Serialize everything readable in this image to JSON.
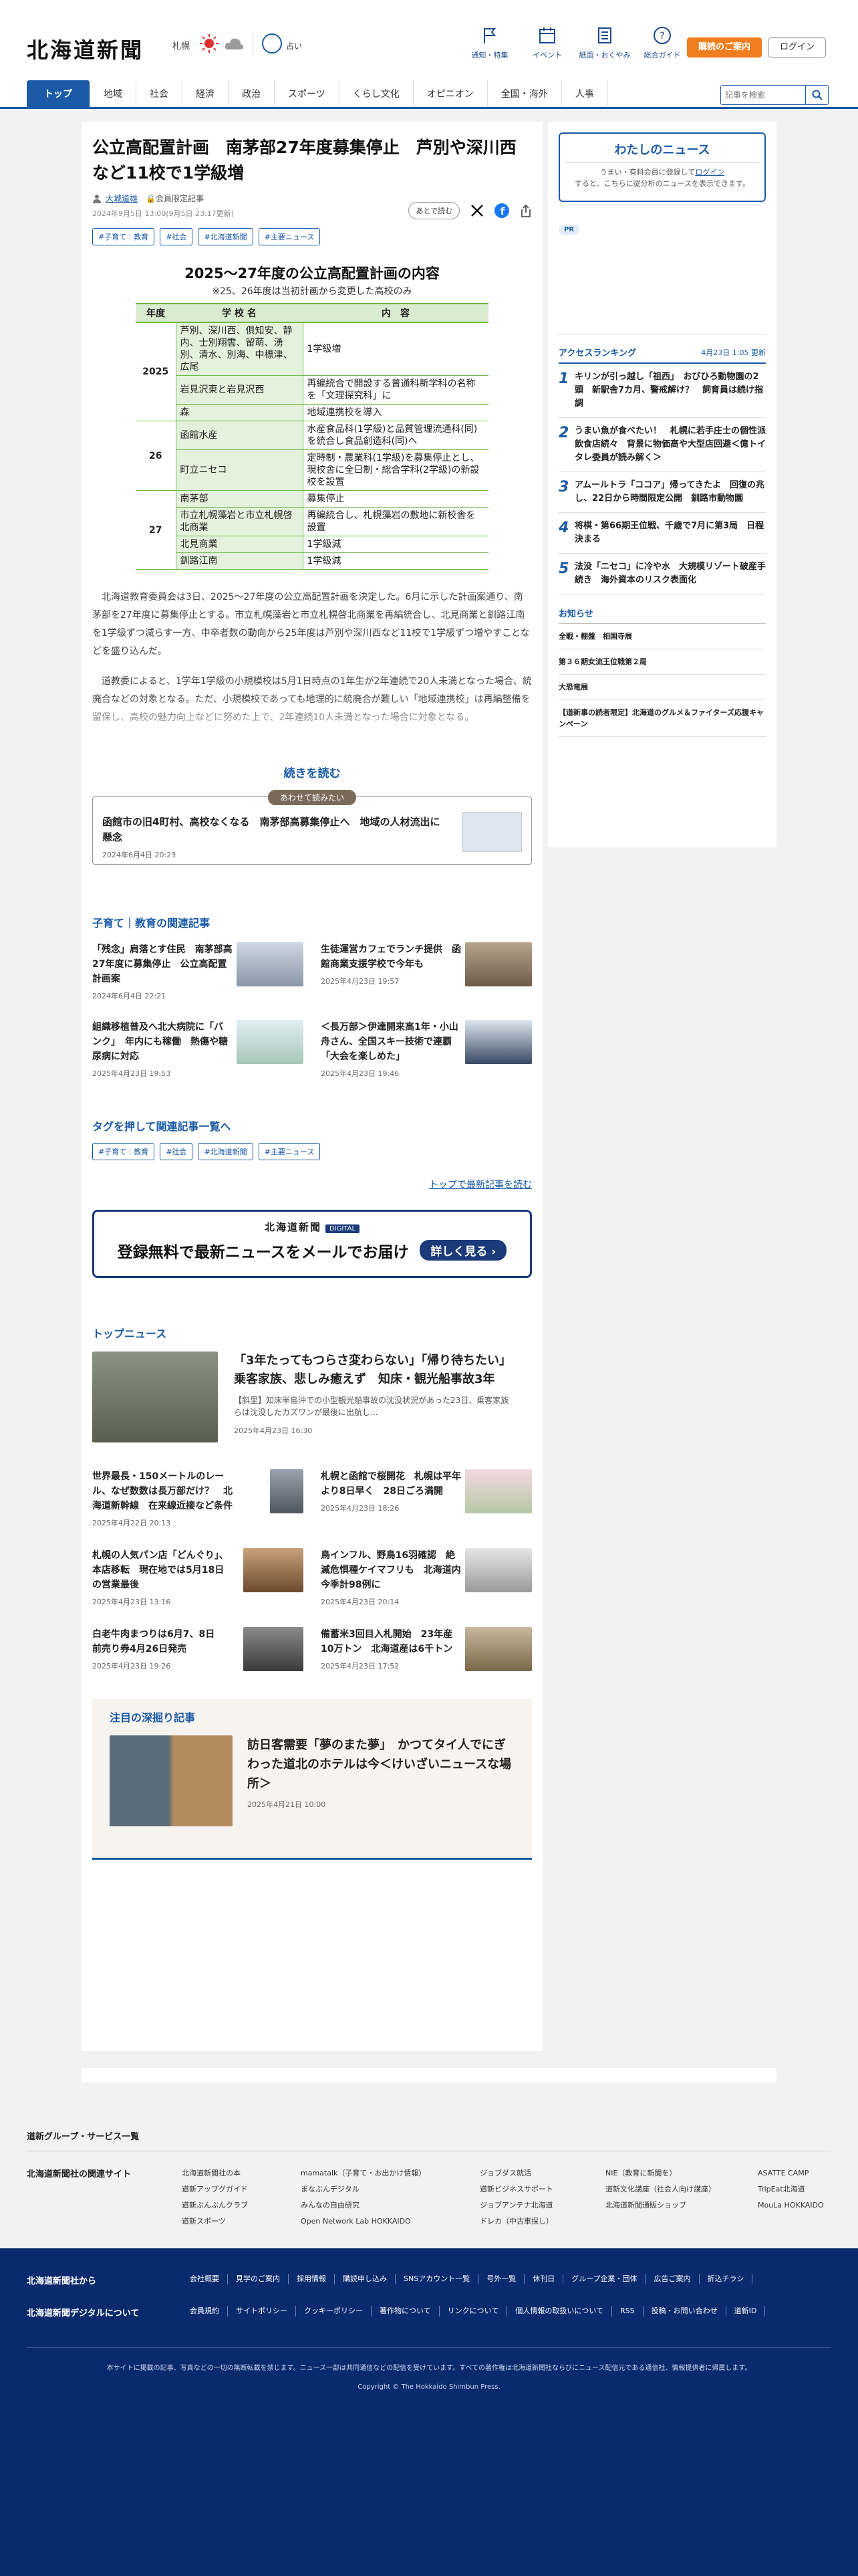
{
  "header": {
    "logo": "北海道新聞",
    "weather_city": "札幌",
    "fortune": "占い",
    "icons": [
      {
        "label": "通知・特集",
        "icon": "flag-icon"
      },
      {
        "label": "イベント",
        "icon": "calendar-icon"
      },
      {
        "label": "紙面・おくやみ",
        "icon": "newspaper-icon"
      },
      {
        "label": "総合ガイド",
        "icon": "help-icon"
      }
    ],
    "subscribe": "購読のご案内",
    "login": "ログイン",
    "search_placeholder": "記事を検索",
    "nav": [
      "トップ",
      "地域",
      "社会",
      "経済",
      "政治",
      "スポーツ",
      "くらし文化",
      "オピニオン",
      "全国・海外",
      "人事"
    ],
    "accent": "#1a5aa6"
  },
  "article": {
    "title": "公立高配置計画　南茅部27年度募集停止　芦別や深川西など11校で1学級増",
    "author": "大城道雄",
    "member": "会員限定記事",
    "date": "2024年9月5日 13:00(9月5日 23:17更新)",
    "later": "あとで読む",
    "tags": [
      "#子育て｜教育",
      "#社会",
      "#北海道新聞",
      "#主要ニュース"
    ],
    "figure": {
      "title": "2025〜27年度の公立高配置計画の内容",
      "subtitle": "※25、26年度は当初計画から変更した高校のみ",
      "headers": [
        "年度",
        "学 校 名",
        "内　容"
      ],
      "rows": [
        {
          "year": "2025",
          "school": "芦別、深川西、俱知安、静内、士別翔雲、留萌、湧別、清水、別海、中標津、広尾",
          "content": "1学級増"
        },
        {
          "year": "",
          "school": "岩見沢東と岩見沢西",
          "content": "再編統合で開設する普通科新学科の名称を「文理探究科」に"
        },
        {
          "year": "",
          "school": "森",
          "content": "地域連携校を導入"
        },
        {
          "year": "26",
          "school": "函館水産",
          "content": "水産食品科(1学級)と品質管理流通科(同)を統合し食品創造科(同)へ"
        },
        {
          "year": "",
          "school": "町立ニセコ",
          "content": "定時制・農業科(1学級)を募集停止とし、現校舎に全日制・総合学科(2学級)の新設校を設置"
        },
        {
          "year": "27",
          "school": "南茅部",
          "content": "募集停止"
        },
        {
          "year": "",
          "school": "市立札幌藻岩と市立札幌啓北商業",
          "content": "再編統合し、札幌藻岩の敷地に新校舎を設置"
        },
        {
          "year": "",
          "school": "北見商業",
          "content": "1学級減"
        },
        {
          "year": "",
          "school": "釧路江南",
          "content": "1学級減"
        }
      ]
    },
    "body1": "北海道教育委員会は3日、2025〜27年度の公立高配置計画を決定した。6月に示した計画案通り、南茅部を27年度に募集停止とする。市立札幌藻岩と市立札幌啓北商業を再編統合し、北見商業と釧路江南を1学級ずつ減らす一方、中卒者数の動向から25年度は芦別や深川西など11校で1学級ずつ増やすことなどを盛り込んだ。",
    "body2": "道教委によると、1学年1学級の小規模校は5月1日時点の1年生が2年連続で20人未満となった場合、統廃合などの対象となる。ただ、小規模校であっても地理的に統廃合が難しい「地域連携校」は再編整備を留保し、高校の魅力向上などに努めた上で、2年連続10人未満となった場合に対象となる。",
    "readmore": "続きを読む",
    "also": {
      "badge": "あわせて読みたい",
      "title": "函館市の旧4町村、高校なくなる　南茅部高募集停止へ　地域の人材流出に懸念",
      "date": "2024年6月4日 20:23"
    }
  },
  "related": {
    "heading": "子育て｜教育の関連記事",
    "items": [
      {
        "title": "「残念」肩落とす住民　南茅部高27年度に募集停止　公立高配置計画案",
        "date": "2024年6月4日 22:21"
      },
      {
        "title": "生徒運営カフェでランチ提供　函館商業支援学校で今年も",
        "date": "2025年4月23日 19:57"
      },
      {
        "title": "組織移植普及へ北大病院に「バンク」　年内にも稼働　熱傷や糖尿病に対応",
        "date": "2025年4月23日 19:53"
      },
      {
        "title": "＜長万部＞伊達開来高1年・小山舟さん、全国スキー技術で連覇　「大会を楽しめた」",
        "date": "2025年4月23日 19:46"
      }
    ]
  },
  "tag_section": {
    "heading": "タグを押して関連記事一覧へ",
    "tags": [
      "#子育て｜教育",
      "#社会",
      "#北海道新聞",
      "#主要ニュース"
    ],
    "latest_link": "トップで最新記事を読む"
  },
  "banner": {
    "logo": "北海道新聞",
    "digital": "DIGITAL",
    "main": "登録無料で最新ニュースをメールでお届け",
    "button": "詳しく見る ›"
  },
  "top_news": {
    "heading": "トップニュース",
    "main": {
      "title": "「3年たってもつらさ変わらない」「帰り待ちたい」　乗客家族、悲しみ癒えず　知床・観光船事故3年",
      "summary": "【斜里】知床半島沖での小型観光船事故の沈没状況があった23日、乗客家族らは沈没したカズワンが最後に出航し...",
      "date": "2025年4月23日 16:30"
    },
    "items": [
      {
        "title": "世界最長・150メートルのレール、なぜ数数は長万部だけ？　北海道新幹線　在来線近接など条件",
        "date": "2025年4月22日 20:13"
      },
      {
        "title": "札幌と函館で桜開花　札幌は平年より8日早く　28日ごろ満開",
        "date": "2025年4月23日 18:26"
      },
      {
        "title": "札幌の人気パン店「どんぐり」、本店移転　現在地では5月18日の営業最後",
        "date": "2025年4月23日 13:16"
      },
      {
        "title": "鳥インフル、野鳥16羽確認　絶滅危惧種ケイマフリも　北海道内今季計98例に",
        "date": "2025年4月23日 20:14"
      },
      {
        "title": "白老牛肉まつりは6月7、8日　前売り券4月26日発売",
        "date": "2025年4月23日 19:26"
      },
      {
        "title": "備蓄米3回目入札開始　23年産10万トン　北海道産は6千トン",
        "date": "2025年4月23日 17:52"
      }
    ]
  },
  "deep_dive": {
    "heading": "注目の深掘り記事",
    "title": "訪日客需要「夢のまた夢」　かつてタイ人でにぎわった道北のホテルは今＜けいざいニュースな場所＞",
    "date": "2025年4月21日 10:00"
  },
  "sidebar": {
    "mynews_title": "わたしのニュース",
    "mynews_text1": "うまい・有料会員に登録して",
    "mynews_link": "ログイン",
    "mynews_text2": "すると、こちらに従分析のニュースを表示できます。",
    "pr": "PR",
    "ranking_title": "アクセスランキング",
    "ranking_date": "4月23日 1:05 更新",
    "ranking": [
      "キリンが引っ越し「祖西」　おびひろ動物園の2頭　新駅舎7カ月、警戒解け？　飼育員は続け指調",
      "うまい魚が食べたい！　札幌に若手庄士の個性派飲食店続々　背景に物価高や大型店回避＜億トイタレ委員が読み解く＞",
      "アムールトラ「ココア」帰ってきたよ　回復の兆し、22日から時間限定公開　釧路市動物園",
      "将棋・第66期王位戦、千歳で7月に第3局　日程決まる",
      "法没「ニセコ」に冷や水　大規模リゾート破産手続き　海外資本のリスク表面化"
    ],
    "notice_title": "お知らせ",
    "notices": [
      "全戦・棚盤　相国寺展",
      "第３６期女流王位戦第２局",
      "大恐竜展",
      "【道新事の読者限定】北海道のグルメ＆ファイターズ応援キャンペーン"
    ]
  },
  "footer": {
    "group_link": "道新グループ・サービス一覧",
    "related_sites": "北海道新聞社の関連サイト",
    "cols": [
      [
        "北海道新聞社の本",
        "道新アップグガイド",
        "道新ぶんぶんクラブ",
        "道新スポーツ"
      ],
      [
        "mamatalk（子育て・お出かけ情報）",
        "まなぶんデジタル",
        "みんなの自由研究",
        "Open Network Lab HOKKAIDO"
      ],
      [
        "ジョブダス就活",
        "道新ビジネスサポート",
        "ジョブアンテナ北海道",
        "ドレカ（中古車探し）"
      ],
      [
        "NIE（教育に新聞を）",
        "道新文化講座（社会人向け講座）",
        "北海道新聞通販ショップ"
      ],
      [
        "ASATTE CAMP",
        "TripEat北海道",
        "MouLa HOKKAIDO"
      ]
    ],
    "company_label": "北海道新聞社から",
    "digital_label": "北海道新聞デジタルについて",
    "company_links": [
      "会社概要",
      "見学のご案内",
      "採用情報",
      "購読申し込み",
      "SNSアカウント一覧",
      "号外一覧",
      "休刊日",
      "グループ企業・団体",
      "広告ご案内",
      "折込チラシ"
    ],
    "digital_links": [
      "会員規約",
      "サイトポリシー",
      "クッキーポリシー",
      "著作物について",
      "リンクについて",
      "個人情報の取扱いについて",
      "RSS",
      "投稿・お問い合わせ",
      "道新ID"
    ],
    "note": "本サイトに掲載の記事、写真などの一切の無断転載を禁じます。ニュース一部は共同通信などの配信を受けています。すべての著作権は北海道新聞社ならびにニュース配信元である通信社、情報提供者に帰属します。",
    "copyright": "Copyright © The Hokkaido Shimbun Press."
  }
}
